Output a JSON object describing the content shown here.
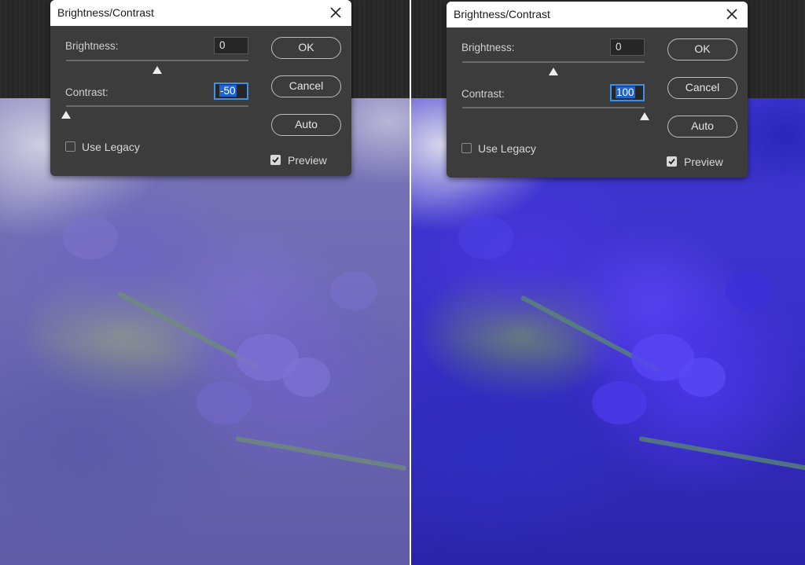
{
  "left": {
    "dialog": {
      "title": "Brightness/Contrast",
      "brightness_label": "Brightness:",
      "brightness_value": "0",
      "contrast_label": "Contrast:",
      "contrast_value": "-50",
      "ok_label": "OK",
      "cancel_label": "Cancel",
      "auto_label": "Auto",
      "use_legacy_label": "Use Legacy",
      "use_legacy_checked": false,
      "preview_label": "Preview",
      "preview_checked": true,
      "brightness_slider": 0.5,
      "contrast_slider": 0.0
    }
  },
  "right": {
    "dialog": {
      "title": "Brightness/Contrast",
      "brightness_label": "Brightness:",
      "brightness_value": "0",
      "contrast_label": "Contrast:",
      "contrast_value": "100",
      "ok_label": "OK",
      "cancel_label": "Cancel",
      "auto_label": "Auto",
      "use_legacy_label": "Use Legacy",
      "use_legacy_checked": false,
      "preview_label": "Preview",
      "preview_checked": true,
      "brightness_slider": 0.5,
      "contrast_slider": 1.0
    }
  },
  "icons": {
    "close": "close-icon",
    "slider_thumb": "slider-thumb-icon",
    "checkmark": "checkmark-icon"
  },
  "colors": {
    "dialog_bg": "#3c3c3c",
    "titlebar_bg": "#ffffff",
    "input_focus": "#3e8fe6",
    "selection": "#1f63cc"
  }
}
